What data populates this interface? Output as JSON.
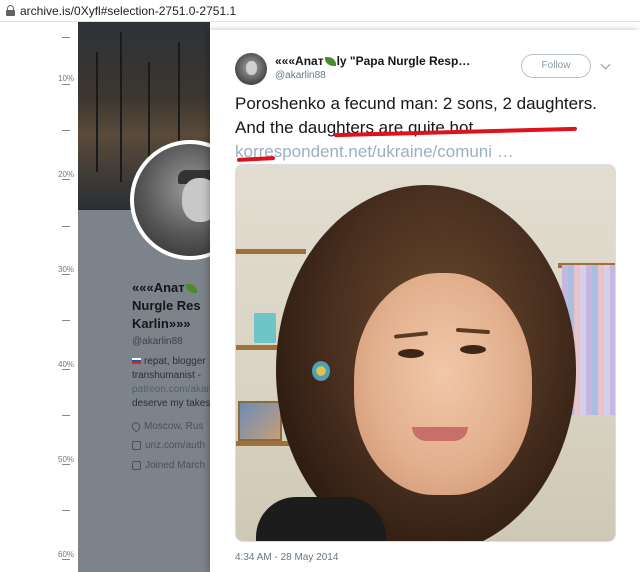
{
  "browser": {
    "url": "archive.is/0Xyfl#selection-2751.0-2751.1"
  },
  "ruler": {
    "labels": [
      "10%",
      "20%",
      "30%",
      "40%",
      "50%",
      "60%"
    ]
  },
  "profile": {
    "name": "«««Anaт🌿ly \"Papa Nurgle Resp… Karlin»»»",
    "name_line1": "«««Anaт",
    "name_line2": "Nurgle Res",
    "name_line3": "Karlin»»»",
    "handle": "@akarlin88",
    "bio_line1": "repat, blogger",
    "bio_line2": "transhumanist - ",
    "bio_line3": "patreon.com/akar",
    "bio_line4": "deserve my takes",
    "location": "Moscow, Rus",
    "website": "unz.com/auth",
    "joined": "Joined March"
  },
  "tweet": {
    "author_name": "«««Anaт🌿ly \"Papa Nurgle Resp…",
    "author_name_pre": "«««Anaт",
    "author_name_post": "ly \"Papa Nurgle Resp…",
    "author_handle": "@akarlin88",
    "follow_label": "Follow",
    "text_part1": "Poroshenko a fecund man: 2 sons, 2 daughters. And the daughters are quite hot.",
    "link_text": " korrespondent.net/ukraine/comuni …",
    "timestamp": "4:34 AM - 28 May 2014"
  },
  "colors": {
    "underline_red": "#e0111b",
    "link_gray": "#9ab0c2",
    "handle_gray": "#657786"
  },
  "icons": {
    "lock": "lock-icon",
    "leaf": "leaf-emoji-icon",
    "caret": "chevron-down-icon",
    "location": "location-pin-icon",
    "link": "link-icon",
    "calendar": "calendar-icon"
  }
}
